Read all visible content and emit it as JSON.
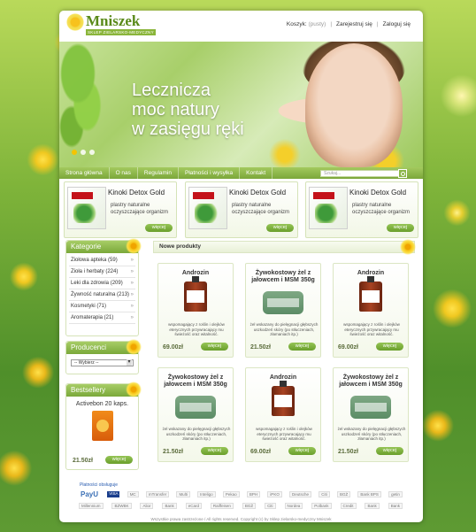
{
  "logo": {
    "title": "Mniszek",
    "subtitle": "SKLEP ZIELARSKO-MEDYCZNY"
  },
  "toplinks": {
    "cart_label": "Koszyk:",
    "cart_status": "(pusty)",
    "register": "Zarejestruj się",
    "login": "Zaloguj się"
  },
  "banner": {
    "line1": "Lecznicza",
    "line2": "moc natury",
    "line3": "w zasięgu ręki",
    "slides": 3,
    "active_slide": 1
  },
  "nav": {
    "items": [
      "Strona główna",
      "O nas",
      "Regulamin",
      "Płatności i wysyłka",
      "Kontakt"
    ],
    "search_placeholder": "Szukaj..."
  },
  "featured": [
    {
      "title": "Kinoki Detox Gold",
      "desc": "plastry naturalne oczyszczające organizm",
      "button": "więcej"
    },
    {
      "title": "Kinoki Detox Gold",
      "desc": "plastry naturalne oczyszczające organizm",
      "button": "więcej"
    },
    {
      "title": "Kinoki Detox Gold",
      "desc": "plastry naturalne oczyszczające organizm",
      "button": "więcej"
    }
  ],
  "sidebar": {
    "categories_title": "Kategorie",
    "categories": [
      "Ziołowa apteka (59)",
      "Zioła i herbaty (224)",
      "Leki dla zdrowia (209)",
      "Żywność naturalna (213)",
      "Kosmetyki (71)",
      "Aromaterapia (21)"
    ],
    "producers_title": "Producenci",
    "producers_select": "-- Wybierz --",
    "bestsellers_title": "Bestsellery",
    "bestseller": {
      "name": "Activebon 20 kaps.",
      "price": "21.50zł",
      "button": "więcej"
    }
  },
  "content": {
    "heading": "Nowe produkty",
    "products": [
      {
        "name": "Androzin",
        "desc": "wspomagający z roślin i olejków eterycznych przywracający mu świeżość oraz witalność.",
        "price": "69.00zł",
        "button": "więcej",
        "img": "bottle"
      },
      {
        "name": "Żywokostowy żel z jałowcem i MSM 350g",
        "desc": "żel wskazany do pielęgnacji głębszych uszkodzeń skóry (po stłuczeniach, złamaniach itp.)",
        "price": "21.50zł",
        "button": "więcej",
        "img": "jar"
      },
      {
        "name": "Androzin",
        "desc": "wspomagający z roślin i olejków eterycznych przywracający mu świeżość oraz witalność.",
        "price": "69.00zł",
        "button": "więcej",
        "img": "bottle"
      },
      {
        "name": "Żywokostowy żel z jałowcem i MSM 350g",
        "desc": "żel wskazany do pielęgnacji głębszych uszkodzeń skóry (po stłuczeniach, złamaniach itp.)",
        "price": "21.50zł",
        "button": "więcej",
        "img": "jar"
      },
      {
        "name": "Androzin",
        "desc": "wspomagający z roślin i olejków eterycznych przywracający mu świeżość oraz witalność.",
        "price": "69.00zł",
        "button": "więcej",
        "img": "bottle"
      },
      {
        "name": "Żywokostowy żel z jałowcem i MSM 350g",
        "desc": "żel wskazany do pielęgnacji głębszych uszkodzeń skóry (po stłuczeniach, złamaniach itp.)",
        "price": "21.50zł",
        "button": "więcej",
        "img": "jar"
      }
    ]
  },
  "payments": {
    "heading": "Płatności obsługuje",
    "row1": [
      "PayU",
      "VISA",
      "MC",
      "mTransfer",
      "Multi",
      "Inteligo",
      "Pekao",
      "BPH",
      "iPKO",
      "Deutsche",
      "Citi",
      "BGŻ",
      "Bank BPS",
      "getin"
    ],
    "row2": [
      "Millennium",
      "BZWBK",
      "Alior",
      "Bank",
      "eCard",
      "Raiffeisen",
      "BGŻ",
      "Citi",
      "Nordea",
      "Polbank",
      "Credit",
      "Bank",
      "Bank"
    ]
  },
  "footer": {
    "text": "Wszystkie prawa zastrzeżone / All rights reserved. Copyright (c) by Sklep zielarsko-medyczny Mniszek"
  }
}
